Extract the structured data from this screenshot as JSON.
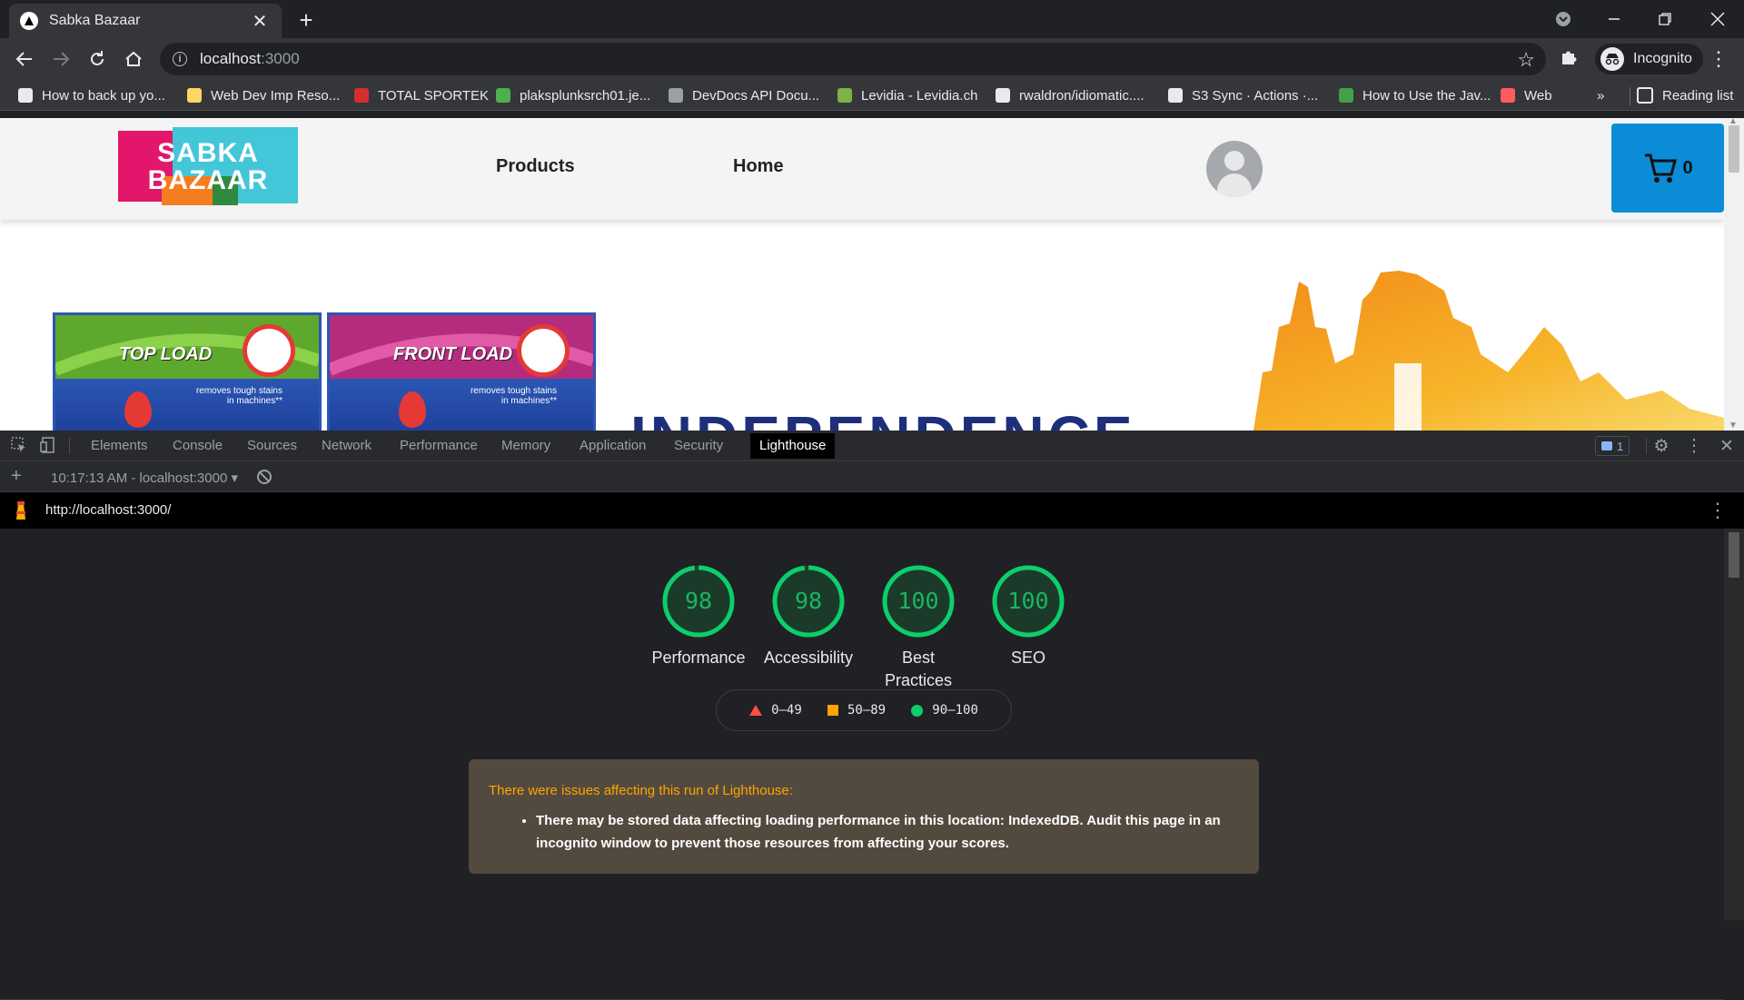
{
  "browser": {
    "tab_title": "Sabka Bazaar",
    "tab_close": "✕",
    "new_tab": "+",
    "url_host": "localhost",
    "url_port": ":3000",
    "profile_label": "Incognito",
    "reading_list": "Reading list",
    "bookmarks_more": "»",
    "bookmarks": [
      {
        "label": "How to back up yo...",
        "icon": "apple-icon",
        "color": "#e8eaed"
      },
      {
        "label": "Web Dev Imp Reso...",
        "icon": "folder-icon",
        "color": "#fdd663"
      },
      {
        "label": "TOTAL SPORTEK",
        "icon": "ts-icon",
        "color": "#d32f2f"
      },
      {
        "label": "plaksplunksrch01.je...",
        "icon": "terminal-icon",
        "color": "#4caf50"
      },
      {
        "label": "DevDocs API Docu...",
        "icon": "devdocs-icon",
        "color": "#9aa0a6"
      },
      {
        "label": "Levidia - Levidia.ch",
        "icon": "levidia-icon",
        "color": "#7cb342"
      },
      {
        "label": "rwaldron/idiomatic....",
        "icon": "github-icon",
        "color": "#e8eaed"
      },
      {
        "label": "S3 Sync · Actions ·...",
        "icon": "github-icon",
        "color": "#e8eaed"
      },
      {
        "label": "How to Use the Jav...",
        "icon": "link-icon",
        "color": "#43a047"
      },
      {
        "label": "Web",
        "icon": "airbnb-icon",
        "color": "#ff5a5f"
      }
    ]
  },
  "site": {
    "logo_line1": "SABKA",
    "logo_line2": "BAZAAR",
    "nav_products": "Products",
    "nav_home": "Home",
    "cart_count": "0",
    "banner_pack1": "TOP LOAD",
    "banner_pack2": "FRONT LOAD",
    "banner_pack_small": "removes tough stains",
    "banner_pack_small2": "in machines**",
    "banner_heading": "INDEPENDENCE"
  },
  "devtools": {
    "tabs": [
      "Elements",
      "Console",
      "Sources",
      "Network",
      "Performance",
      "Memory",
      "Application",
      "Security",
      "Lighthouse"
    ],
    "active_tab": "Lighthouse",
    "issues_count": "1",
    "report_select": "10:17:13 AM - localhost:3000 ▾",
    "report_url": "http://localhost:3000/"
  },
  "lighthouse": {
    "scores": [
      {
        "label": "Performance",
        "score": "98",
        "value": 0.98
      },
      {
        "label": "Accessibility",
        "score": "98",
        "value": 0.98
      },
      {
        "label": "Best Practices",
        "score": "100",
        "value": 1.0
      },
      {
        "label": "SEO",
        "score": "100",
        "value": 1.0
      }
    ],
    "gauge_color": "#0cce6b",
    "legend": [
      {
        "range": "0–49",
        "shape": "triangle",
        "color": "#ff4e42"
      },
      {
        "range": "50–89",
        "shape": "square",
        "color": "#ffa400"
      },
      {
        "range": "90–100",
        "shape": "circle",
        "color": "#0cce6b"
      }
    ],
    "warning_title": "There were issues affecting this run of Lighthouse:",
    "warning_items": [
      "There may be stored data affecting loading performance in this location: IndexedDB. Audit this page in an incognito window to prevent those resources from affecting your scores."
    ]
  }
}
